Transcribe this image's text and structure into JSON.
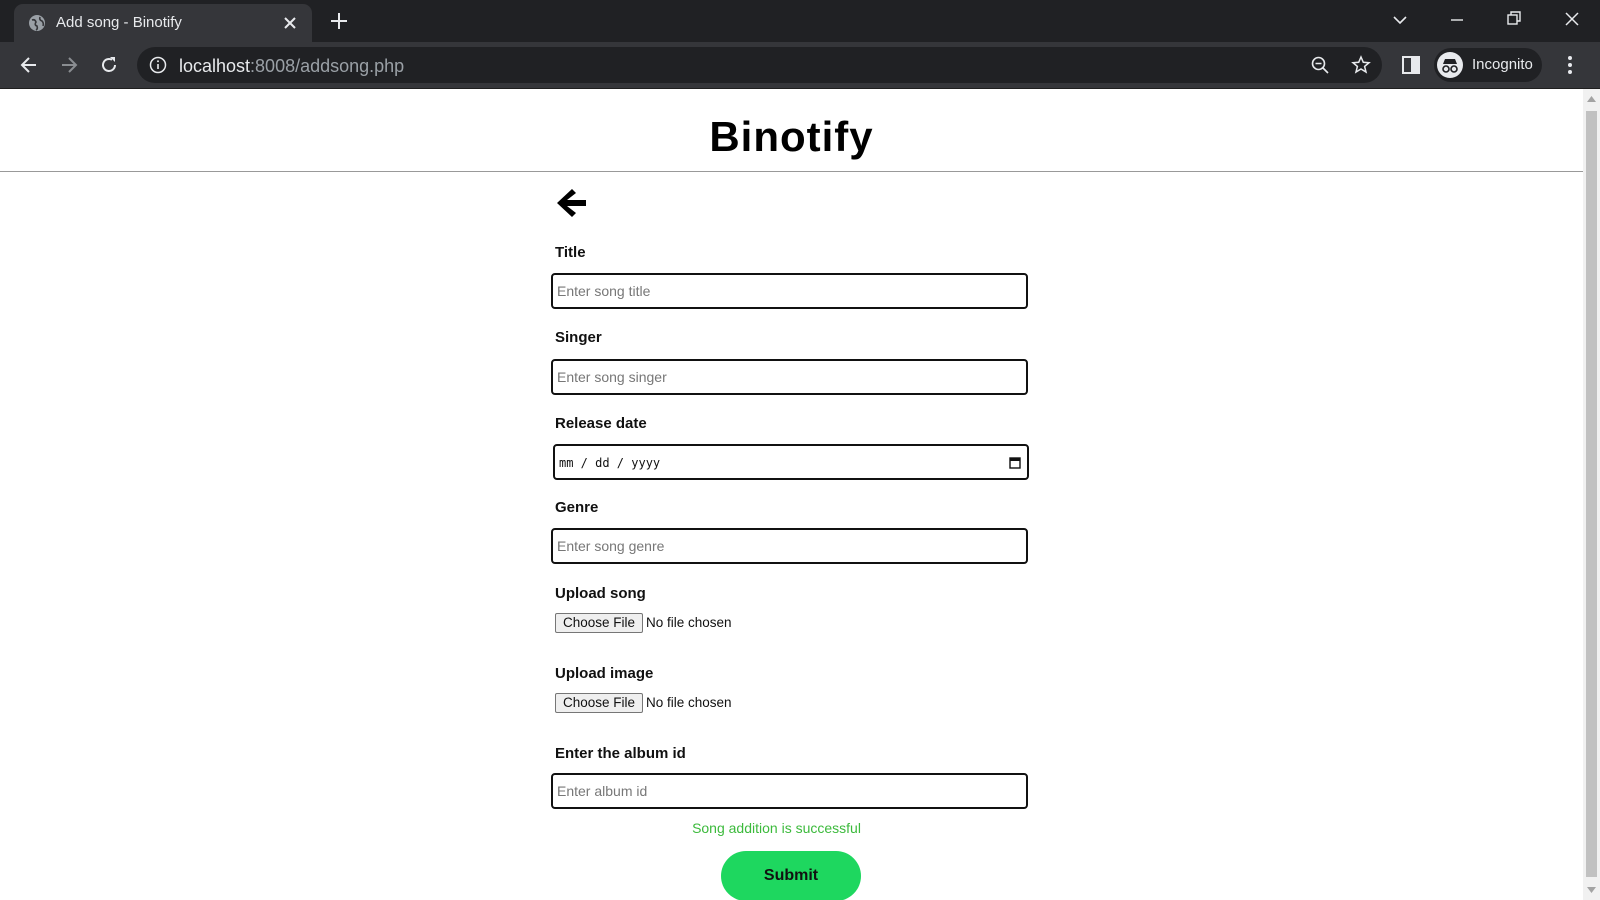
{
  "browser": {
    "tab_title": "Add song - Binotify",
    "url_host": "localhost",
    "url_rest": ":8008/addsong.php",
    "profile_label": "Incognito"
  },
  "page": {
    "site_title": "Binotify",
    "fields": {
      "title": {
        "label": "Title",
        "placeholder": "Enter song title",
        "value": ""
      },
      "singer": {
        "label": "Singer",
        "placeholder": "Enter song singer",
        "value": ""
      },
      "release_date": {
        "label": "Release date",
        "display": "mm / dd / yyyy"
      },
      "genre": {
        "label": "Genre",
        "placeholder": "Enter song genre",
        "value": ""
      },
      "upload_song": {
        "label": "Upload song",
        "button": "Choose File",
        "status": "No file chosen"
      },
      "upload_image": {
        "label": "Upload image",
        "button": "Choose File",
        "status": "No file chosen"
      },
      "album_id": {
        "label": "Enter the album id",
        "placeholder": "Enter album id",
        "value": ""
      }
    },
    "success_message": "Song addition is successful",
    "submit_label": "Submit",
    "colors": {
      "success": "#3cba3c",
      "submit_bg": "#1ed75f"
    }
  }
}
